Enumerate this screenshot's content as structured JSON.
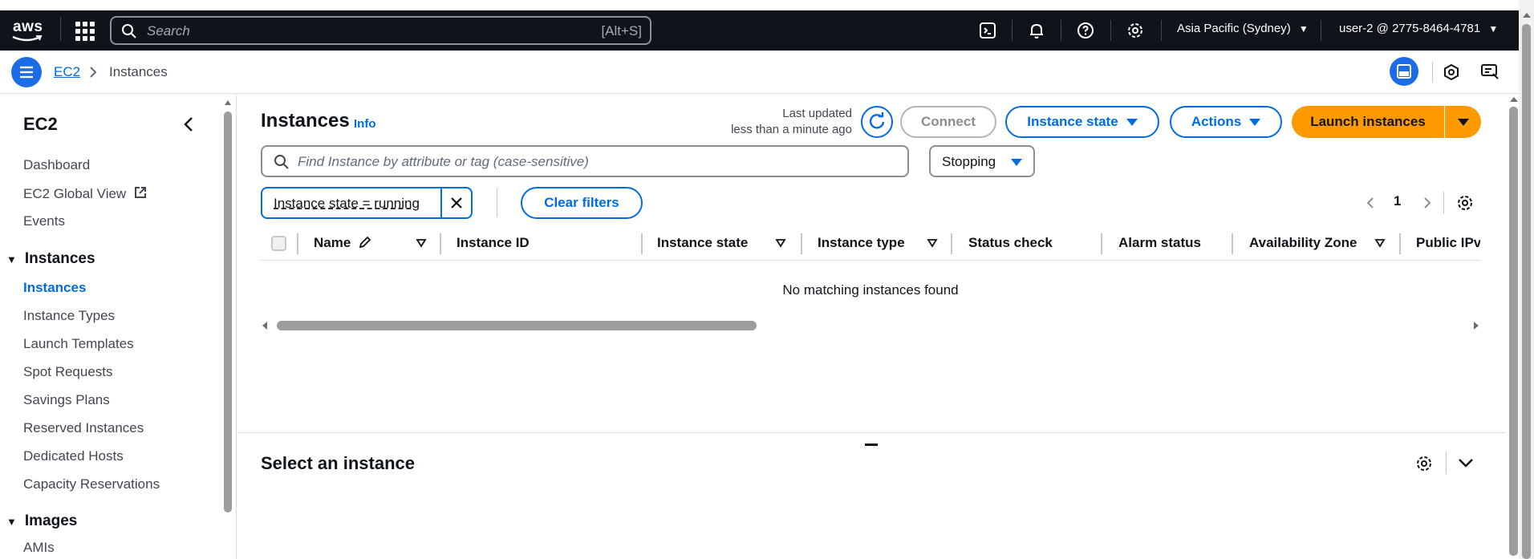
{
  "topbar": {
    "logo": "aws",
    "search_placeholder": "Search",
    "search_shortcut": "[Alt+S]",
    "region": "Asia Pacific (Sydney)",
    "user": "user-2 @ 2775-8464-4781"
  },
  "breadcrumb": {
    "service": "EC2",
    "current": "Instances"
  },
  "sidebar": {
    "title": "EC2",
    "top_items": [
      "Dashboard",
      "EC2 Global View",
      "Events"
    ],
    "sections": [
      {
        "title": "Instances",
        "items": [
          "Instances",
          "Instance Types",
          "Launch Templates",
          "Spot Requests",
          "Savings Plans",
          "Reserved Instances",
          "Dedicated Hosts",
          "Capacity Reservations"
        ]
      },
      {
        "title": "Images",
        "items": [
          "AMIs"
        ]
      }
    ]
  },
  "main": {
    "title": "Instances",
    "info": "Info",
    "last_updated_label": "Last updated",
    "last_updated_value": "less than a minute ago",
    "buttons": {
      "connect": "Connect",
      "instance_state": "Instance state",
      "actions": "Actions",
      "launch": "Launch instances",
      "clear_filters": "Clear filters"
    },
    "filter_placeholder": "Find Instance by attribute or tag (case-sensitive)",
    "state_select": "Stopping",
    "token": "Instance state = running",
    "page": "1",
    "columns": [
      "Name",
      "Instance ID",
      "Instance state",
      "Instance type",
      "Status check",
      "Alarm status",
      "Availability Zone",
      "Public IPv"
    ],
    "empty_message": "No matching instances found",
    "detail_title": "Select an instance"
  },
  "colors": {
    "topbar_bg": "#0f141a",
    "link": "#006ce0",
    "primary": "#ff9900"
  }
}
